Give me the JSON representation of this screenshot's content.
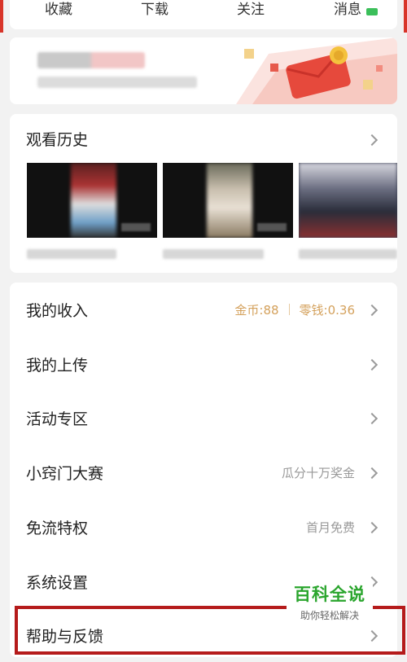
{
  "top_tabs": [
    "收藏",
    "下载",
    "关注",
    "消息"
  ],
  "history": {
    "title": "观看历史"
  },
  "menu": {
    "items": [
      {
        "label": "我的收入",
        "hint": ""
      },
      {
        "label": "我的上传",
        "hint": ""
      },
      {
        "label": "活动专区",
        "hint": ""
      },
      {
        "label": "小窍门大赛",
        "hint": "瓜分十万奖金"
      },
      {
        "label": "免流特权",
        "hint": "首月免费"
      },
      {
        "label": "系统设置",
        "hint": ""
      },
      {
        "label": "帮助与反馈",
        "hint": ""
      }
    ],
    "income": {
      "coins": "金币:88",
      "change": "零钱:0.36"
    }
  },
  "watermark": {
    "main": "百科全说",
    "sub": "助你轻松解决"
  },
  "colors": {
    "accent_red": "#d8352a",
    "coin_gold": "#d4a15c",
    "highlight": "#b51b1b",
    "watermark_green": "#2aa52d"
  }
}
